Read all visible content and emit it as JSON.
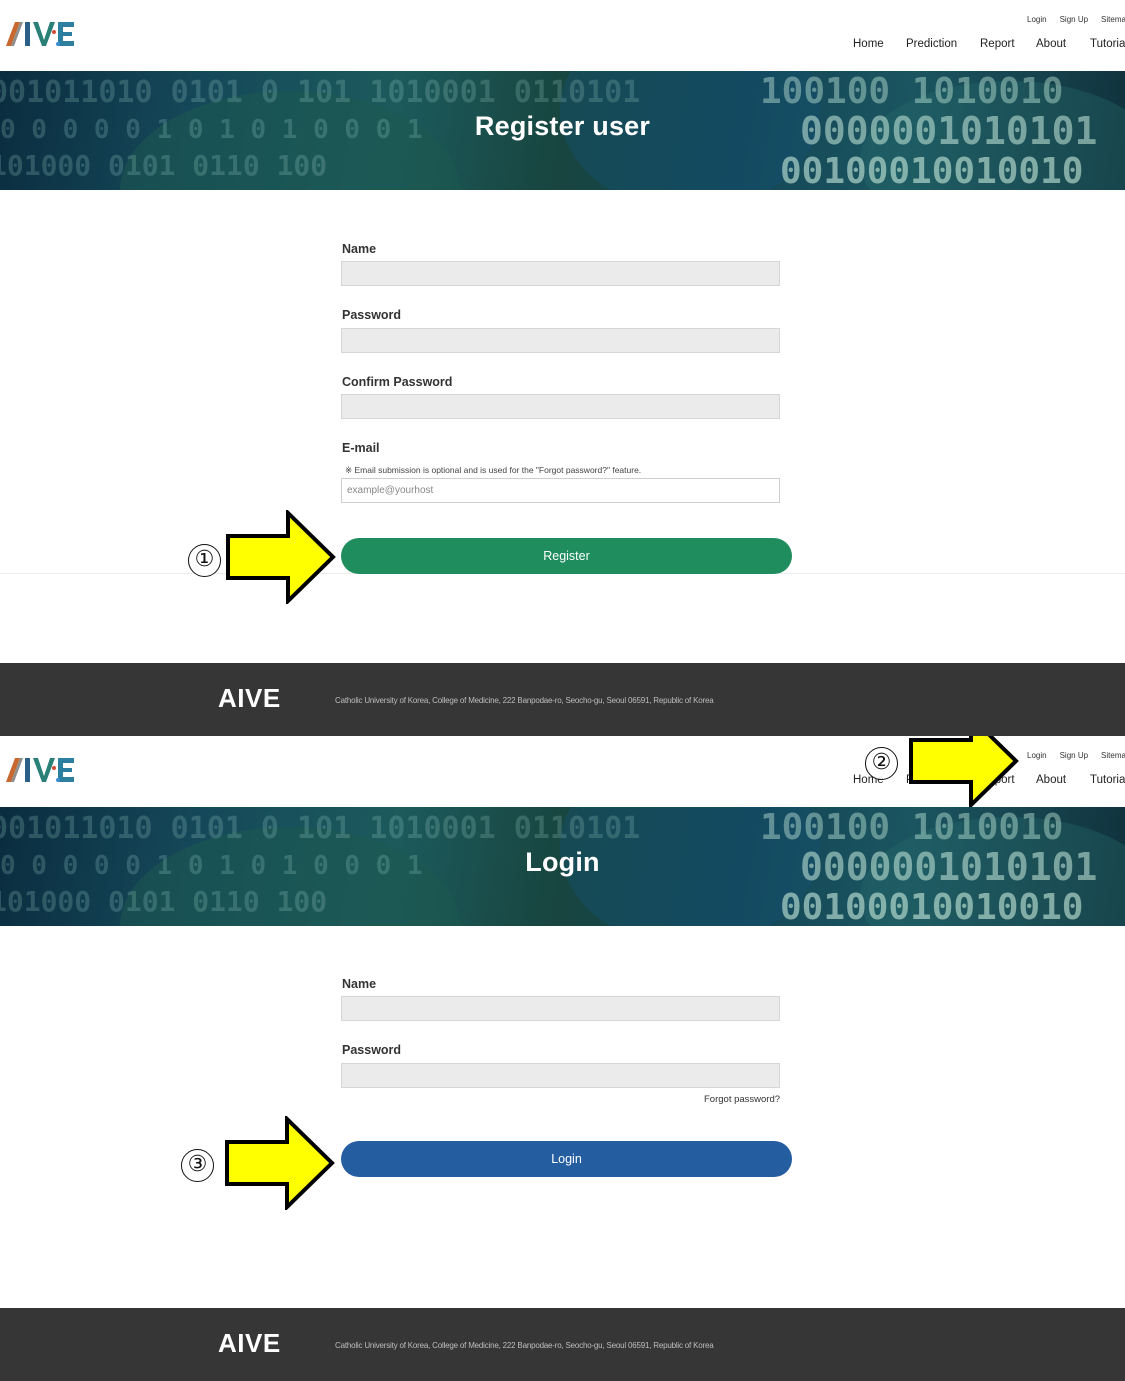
{
  "header": {
    "logo_text": "AIVE",
    "util_nav": [
      "Login",
      "Sign Up",
      "Sitemap"
    ],
    "main_nav": [
      "Home",
      "Prediction",
      "Report",
      "About",
      "Tutoria"
    ]
  },
  "register": {
    "banner_title": "Register user",
    "fields": {
      "name_label": "Name",
      "password_label": "Password",
      "confirm_label": "Confirm Password",
      "email_label": "E-mail",
      "email_note": "※ Email submission is optional and is used for the \"Forgot password?\" feature.",
      "email_placeholder": "example@yourhost"
    },
    "submit_label": "Register"
  },
  "login": {
    "banner_title": "Login",
    "fields": {
      "name_label": "Name",
      "password_label": "Password"
    },
    "forgot_label": "Forgot password?",
    "submit_label": "Login"
  },
  "footer": {
    "logo_text": "AIVE",
    "address": "Catholic University of Korea, College of Medicine, 222 Banpodae-ro, Seocho-gu, Seoul 06591, Republic of Korea"
  },
  "annotations": {
    "step1": "①",
    "step2": "②",
    "step3": "③",
    "arrow_color": "#ffff00"
  },
  "colors": {
    "register_button": "#1f8d5e",
    "login_button": "#245da0",
    "footer_bg": "#363636"
  }
}
